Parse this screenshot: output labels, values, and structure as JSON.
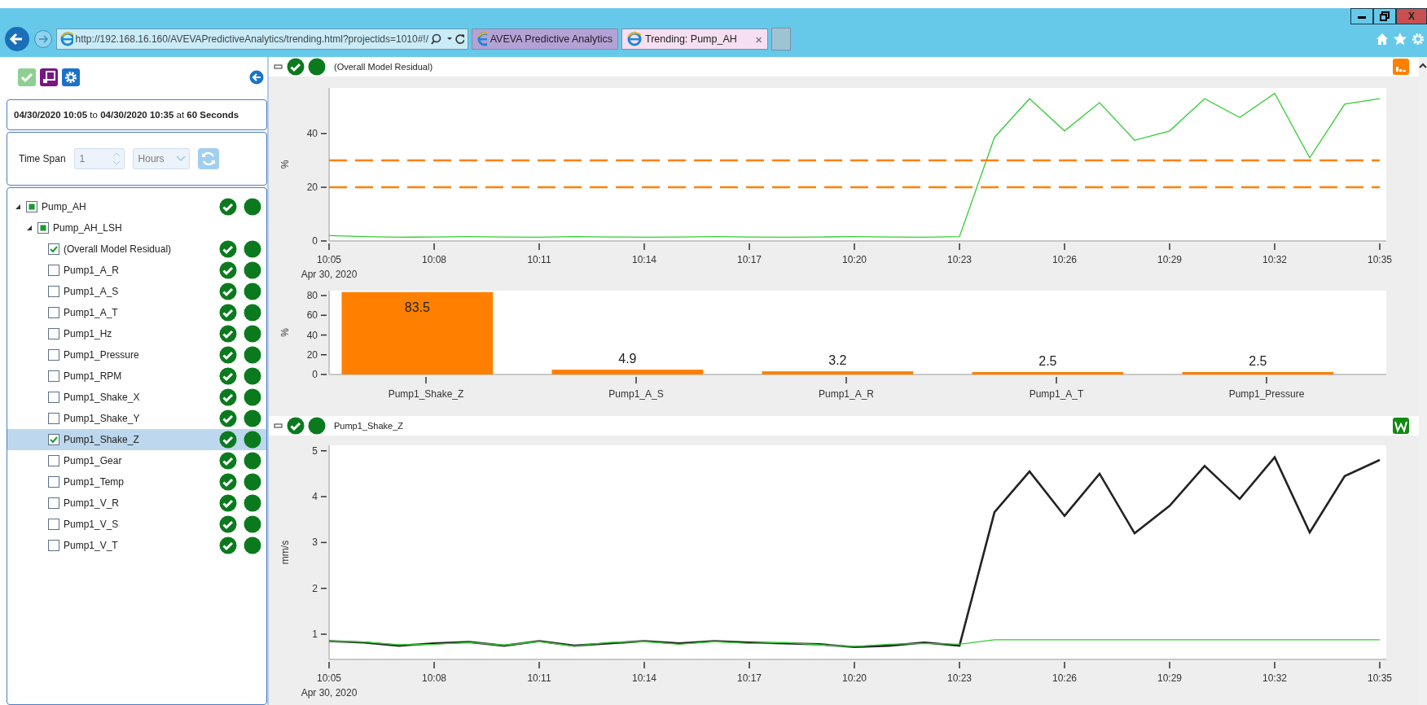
{
  "browser": {
    "url": "http://192.168.16.160/AVEVAPredictiveAnalytics/trending.html?projectids=1010#!/",
    "tabs": [
      {
        "title": "AVEVA Predictive Analytics",
        "selected": false
      },
      {
        "title": "Trending: Pump_AH",
        "selected": true
      }
    ],
    "tab_close": "×",
    "close_button": "X"
  },
  "sidebar": {
    "date_range": "**04/30/2020 10:05** to **04/30/2020 10:35** at **60 Seconds**",
    "time_span": {
      "label": "Time Span",
      "value": "1",
      "unit": "Hours",
      "disabled": true
    },
    "tree": [
      {
        "label": "Pump_AH",
        "checked": false,
        "partial": true,
        "expanded": true,
        "status": true,
        "selected": false,
        "children": [
          {
            "label": "Pump_AH_LSH",
            "checked": false,
            "partial": true,
            "expanded": true,
            "status": false,
            "selected": false,
            "children": [
              {
                "label": "(Overall Model Residual)",
                "checked": true,
                "partial": false,
                "status": true,
                "selected": false
              },
              {
                "label": "Pump1_A_R",
                "checked": false,
                "partial": false,
                "status": true,
                "selected": false
              },
              {
                "label": "Pump1_A_S",
                "checked": false,
                "partial": false,
                "status": true,
                "selected": false
              },
              {
                "label": "Pump1_A_T",
                "checked": false,
                "partial": false,
                "status": true,
                "selected": false
              },
              {
                "label": "Pump1_Hz",
                "checked": false,
                "partial": false,
                "status": true,
                "selected": false
              },
              {
                "label": "Pump1_Pressure",
                "checked": false,
                "partial": false,
                "status": true,
                "selected": false
              },
              {
                "label": "Pump1_RPM",
                "checked": false,
                "partial": false,
                "status": true,
                "selected": false
              },
              {
                "label": "Pump1_Shake_X",
                "checked": false,
                "partial": false,
                "status": true,
                "selected": false
              },
              {
                "label": "Pump1_Shake_Y",
                "checked": false,
                "partial": false,
                "status": true,
                "selected": false
              },
              {
                "label": "Pump1_Shake_Z",
                "checked": true,
                "partial": false,
                "status": true,
                "selected": true
              },
              {
                "label": "Pump1_Gear",
                "checked": false,
                "partial": false,
                "status": true,
                "selected": false
              },
              {
                "label": "Pump1_Temp",
                "checked": false,
                "partial": false,
                "status": true,
                "selected": false
              },
              {
                "label": "Pump1_V_R",
                "checked": false,
                "partial": false,
                "status": true,
                "selected": false
              },
              {
                "label": "Pump1_V_S",
                "checked": false,
                "partial": false,
                "status": true,
                "selected": false
              },
              {
                "label": "Pump1_V_T",
                "checked": false,
                "partial": false,
                "status": true,
                "selected": false
              }
            ]
          }
        ]
      }
    ]
  },
  "panels": [
    {
      "title": "(Overall Model Residual)",
      "color": "#ff7f00",
      "kind": "residual",
      "trend": {
        "x_date": "Apr 30, 2020",
        "chart_data": {
          "type": "line",
          "ylabel": "%",
          "categories": [
            "10:05",
            null,
            null,
            "10:08",
            null,
            null,
            "10:11",
            null,
            null,
            "10:14",
            null,
            null,
            "10:17",
            null,
            null,
            "10:20",
            null,
            null,
            "10:23",
            null,
            null,
            "10:26",
            null,
            null,
            "10:29",
            null,
            null,
            "10:32",
            null,
            null,
            "10:35"
          ],
          "ylim": [
            0,
            57
          ],
          "yticks": [
            0,
            20,
            40
          ],
          "series": [
            {
              "color": "#33cc33",
              "values": [
                2,
                1.6,
                1.4,
                1.5,
                1.6,
                1.5,
                1.4,
                1.6,
                1.5,
                1.4,
                1.5,
                1.6,
                1.5,
                1.4,
                1.5,
                1.6,
                1.5,
                1.4,
                1.6,
                38.6,
                53,
                41,
                51.5,
                37.5,
                41,
                53,
                46,
                55,
                31,
                51,
                53
              ]
            },
            {
              "color": "#ff8000",
              "line_style": "dashed",
              "values": [
                30,
                30,
                30,
                30,
                30,
                30,
                30,
                30,
                30,
                30,
                30,
                30,
                30,
                30,
                30,
                30,
                30,
                30,
                30,
                30,
                30,
                30,
                30,
                30,
                30,
                30,
                30,
                30,
                30,
                30,
                30
              ]
            },
            {
              "color": "#ff8000",
              "line_style": "dashed",
              "values": [
                20,
                20,
                20,
                20,
                20,
                20,
                20,
                20,
                20,
                20,
                20,
                20,
                20,
                20,
                20,
                20,
                20,
                20,
                20,
                20,
                20,
                20,
                20,
                20,
                20,
                20,
                20,
                20,
                20,
                20,
                20
              ]
            }
          ]
        }
      },
      "contributions": {
        "chart_data": {
          "type": "bar",
          "ylabel": "%",
          "categories": [
            "Pump1_Shake_Z",
            "Pump1_A_S",
            "Pump1_A_R",
            "Pump1_A_T",
            "Pump1_Pressure"
          ],
          "ylim": [
            0,
            85
          ],
          "yticks": [
            0,
            20,
            40,
            60,
            80
          ],
          "data_labels": true,
          "series": [
            {
              "color": "#ff8000",
              "values": [
                83.5,
                4.9,
                3.2,
                2.5,
                2.5
              ]
            }
          ]
        }
      }
    },
    {
      "title": "Pump1_Shake_Z",
      "color": "#108a10",
      "kind": "signal",
      "trend": {
        "x_date": "Apr 30, 2020",
        "chart_data": {
          "type": "line",
          "ylabel": "mm/s",
          "categories": [
            "10:05",
            null,
            null,
            "10:08",
            null,
            null,
            "10:11",
            null,
            null,
            "10:14",
            null,
            null,
            "10:17",
            null,
            null,
            "10:20",
            null,
            null,
            "10:23",
            null,
            null,
            "10:26",
            null,
            null,
            "10:29",
            null,
            null,
            "10:32",
            null,
            null,
            "10:35"
          ],
          "ylim": [
            0.45,
            5.12
          ],
          "yticks": [
            1,
            2,
            3,
            4,
            5
          ],
          "series": [
            {
              "color": "#222222",
              "values": [
                0.85,
                0.82,
                0.75,
                0.8,
                0.83,
                0.75,
                0.85,
                0.75,
                0.8,
                0.85,
                0.8,
                0.85,
                0.82,
                0.8,
                0.78,
                0.72,
                0.75,
                0.82,
                0.75,
                3.66,
                4.55,
                3.58,
                4.5,
                3.2,
                3.8,
                4.67,
                3.95,
                4.86,
                3.22,
                4.45,
                4.8
              ]
            },
            {
              "color": "#33cc33",
              "values": [
                0.85,
                0.83,
                0.77,
                0.78,
                0.82,
                0.76,
                0.84,
                0.74,
                0.82,
                0.84,
                0.78,
                0.84,
                0.8,
                0.82,
                0.77,
                0.73,
                0.78,
                0.8,
                0.78,
                0.88,
                0.88,
                0.88,
                0.88,
                0.88,
                0.88,
                0.88,
                0.88,
                0.88,
                0.88,
                0.88,
                0.88
              ]
            }
          ]
        }
      }
    }
  ]
}
